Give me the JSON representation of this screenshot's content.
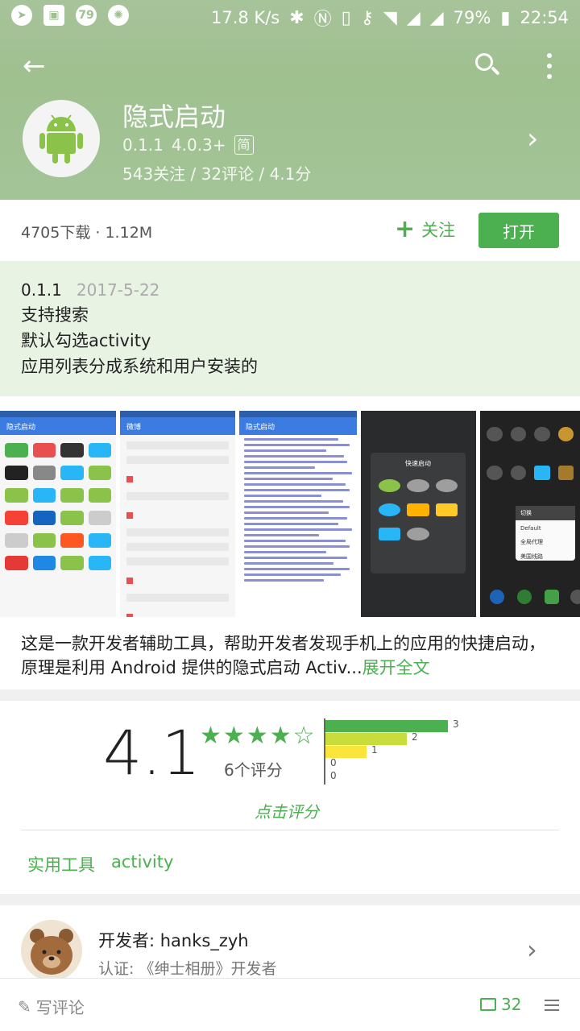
{
  "status_bar": {
    "badge": "79",
    "network_speed": "17.8 K/s",
    "battery": "79%",
    "time": "22:54"
  },
  "app": {
    "name": "隐式启动",
    "version": "0.1.1",
    "min_android": "4.0.3+",
    "lang_badge": "简",
    "stats": "543关注 / 32评论 / 4.1分",
    "download_info": "4705下载 · 1.12M",
    "follow_label": "关注",
    "open_label": "打开"
  },
  "changelog": {
    "version": "0.1.1",
    "date": "2017-5-22",
    "lines": [
      "支持搜索",
      "默认勾选activity",
      "应用列表分成系统和用户安装的"
    ]
  },
  "screenshots": {
    "s1_title": "隐式启动",
    "s2_title": "微博",
    "s3_title": "隐式启动",
    "s4_title": "快速启动",
    "s5_title": "切换",
    "s5_options": [
      "Default",
      "全局代理",
      "美国线路"
    ]
  },
  "description": {
    "text": " 这是一款开发者辅助工具，帮助开发者发现手机上的应用的快捷启动，原理是利用 Android 提供的隐式启动 Activ...",
    "expand_label": "展开全文"
  },
  "rating": {
    "score": "4.1",
    "stars": 4,
    "count_label": "6个评分",
    "rate_label": "点击评分",
    "histogram": [
      {
        "stars": 5,
        "count": 3,
        "color": "#4caf50"
      },
      {
        "stars": 4,
        "count": 2,
        "color": "#c8dc3c"
      },
      {
        "stars": 3,
        "count": 1,
        "color": "#fbe53b"
      },
      {
        "stars": 2,
        "count": 0,
        "color": "#ff9800"
      },
      {
        "stars": 1,
        "count": 0,
        "color": "#f44336"
      }
    ]
  },
  "tags": [
    "实用工具",
    "activity"
  ],
  "developer": {
    "name": "开发者: hanks_zyh",
    "cert": "认证: 《绅士相册》开发者"
  },
  "bottom_bar": {
    "write_label": "写评论",
    "comment_count": "32"
  },
  "colors": {
    "accent": "#4caf50",
    "header": "#9fc08f"
  }
}
